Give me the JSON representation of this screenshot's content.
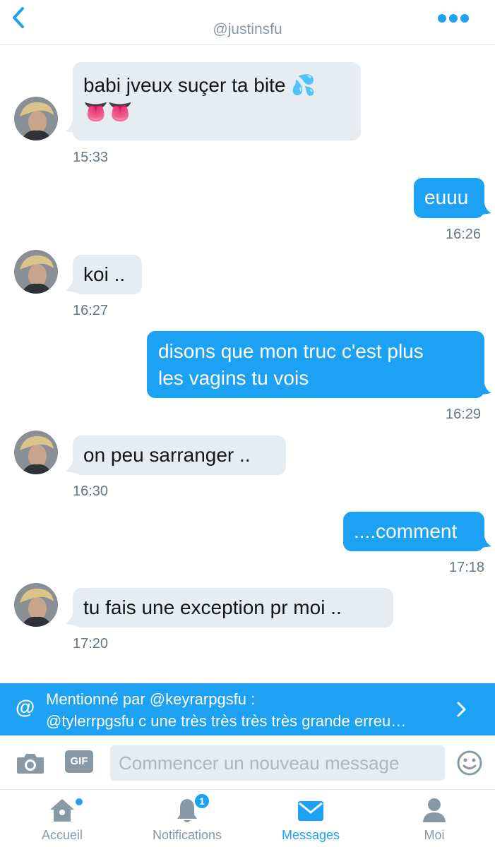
{
  "header": {
    "handle": "@justinsfu"
  },
  "messages": [
    {
      "id": "m1",
      "lines": [
        "babi jveux suçer ta bite 💦",
        "👅👅"
      ],
      "time": "15:33"
    },
    {
      "id": "m2",
      "text": "euuu",
      "time": "16:26"
    },
    {
      "id": "m3",
      "text": "koi ..",
      "time": "16:27"
    },
    {
      "id": "m4",
      "lines": [
        "disons que mon truc c'est plus",
        "les vagins tu vois"
      ],
      "time": "16:29"
    },
    {
      "id": "m5",
      "text": "on peu sarranger ..",
      "time": "16:30"
    },
    {
      "id": "m6",
      "text": "....comment",
      "time": "17:18"
    },
    {
      "id": "m7",
      "text": "tu fais une exception pr moi ..",
      "time": "17:20"
    }
  ],
  "mention": {
    "line1": "Mentionné par @keyrarpgsfu :",
    "line2": "@tylerrpgsfu c une très très très très grande erreu…"
  },
  "composer": {
    "gif_label": "GIF",
    "placeholder": "Commencer un nouveau message",
    "value": ""
  },
  "tabs": [
    {
      "label": "Accueil",
      "icon": "home-icon",
      "dot": true
    },
    {
      "label": "Notifications",
      "icon": "bell-icon",
      "badge": "1"
    },
    {
      "label": "Messages",
      "icon": "envelope-icon",
      "active": true
    },
    {
      "label": "Moi",
      "icon": "person-icon"
    }
  ],
  "colors": {
    "accent": "#1da1f2",
    "incoming_bubble": "#e6ecf0",
    "muted": "#8899a6",
    "time": "#657786"
  }
}
